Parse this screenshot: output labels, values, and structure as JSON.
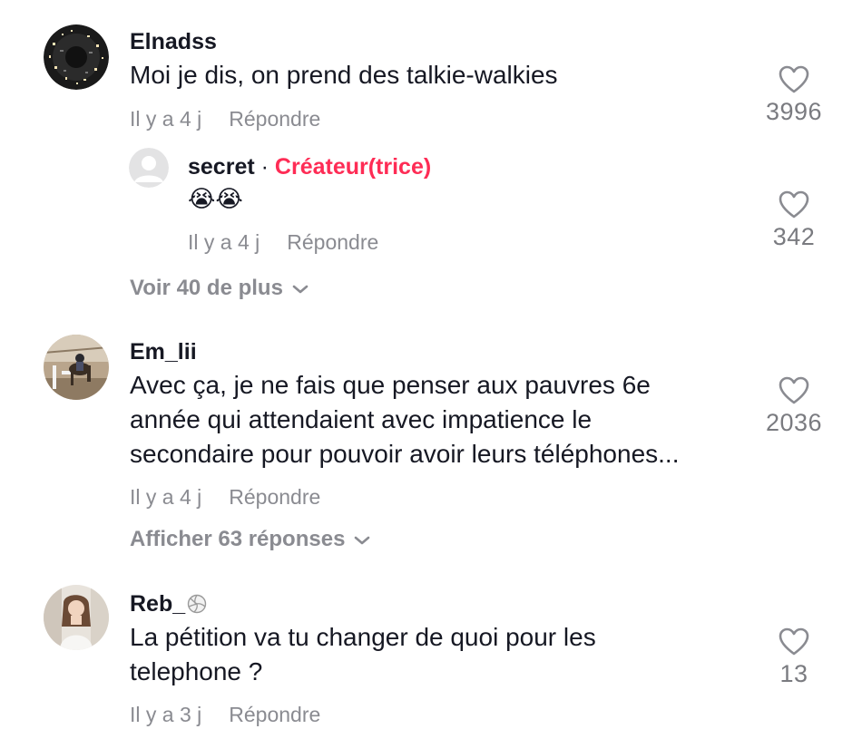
{
  "comments": [
    {
      "username": "Elnadss",
      "text": "Moi je dis, on prend des talkie-walkies",
      "time": "Il y a 4 j",
      "reply": "Répondre",
      "likes": "3996",
      "replies": [
        {
          "username": "secret",
          "separator": "·",
          "role": "Créateur(trice)",
          "text": "😭😭",
          "time": "Il y a 4 j",
          "reply": "Répondre",
          "likes": "342"
        }
      ],
      "more": "Voir 40 de plus"
    },
    {
      "username": "Em_lii",
      "text_lines": [
        "Avec ça, je ne fais que penser aux pauvres 6e",
        "année qui attendaient avec impatience le",
        "secondaire pour pouvoir avoir leurs téléphones..."
      ],
      "time": "Il y a 4 j",
      "reply": "Répondre",
      "likes": "2036",
      "more": "Afficher 63 réponses"
    },
    {
      "username": "Reb_",
      "badge": "volleyball-icon",
      "text_lines": [
        "La pétition va tu changer de quoi pour les",
        "telephone ?"
      ],
      "time": "Il y a 3 j",
      "reply": "Répondre",
      "likes": "13"
    }
  ],
  "colors": {
    "creator": "#fe2c55",
    "meta": "#8a8b91",
    "text": "#161823"
  }
}
